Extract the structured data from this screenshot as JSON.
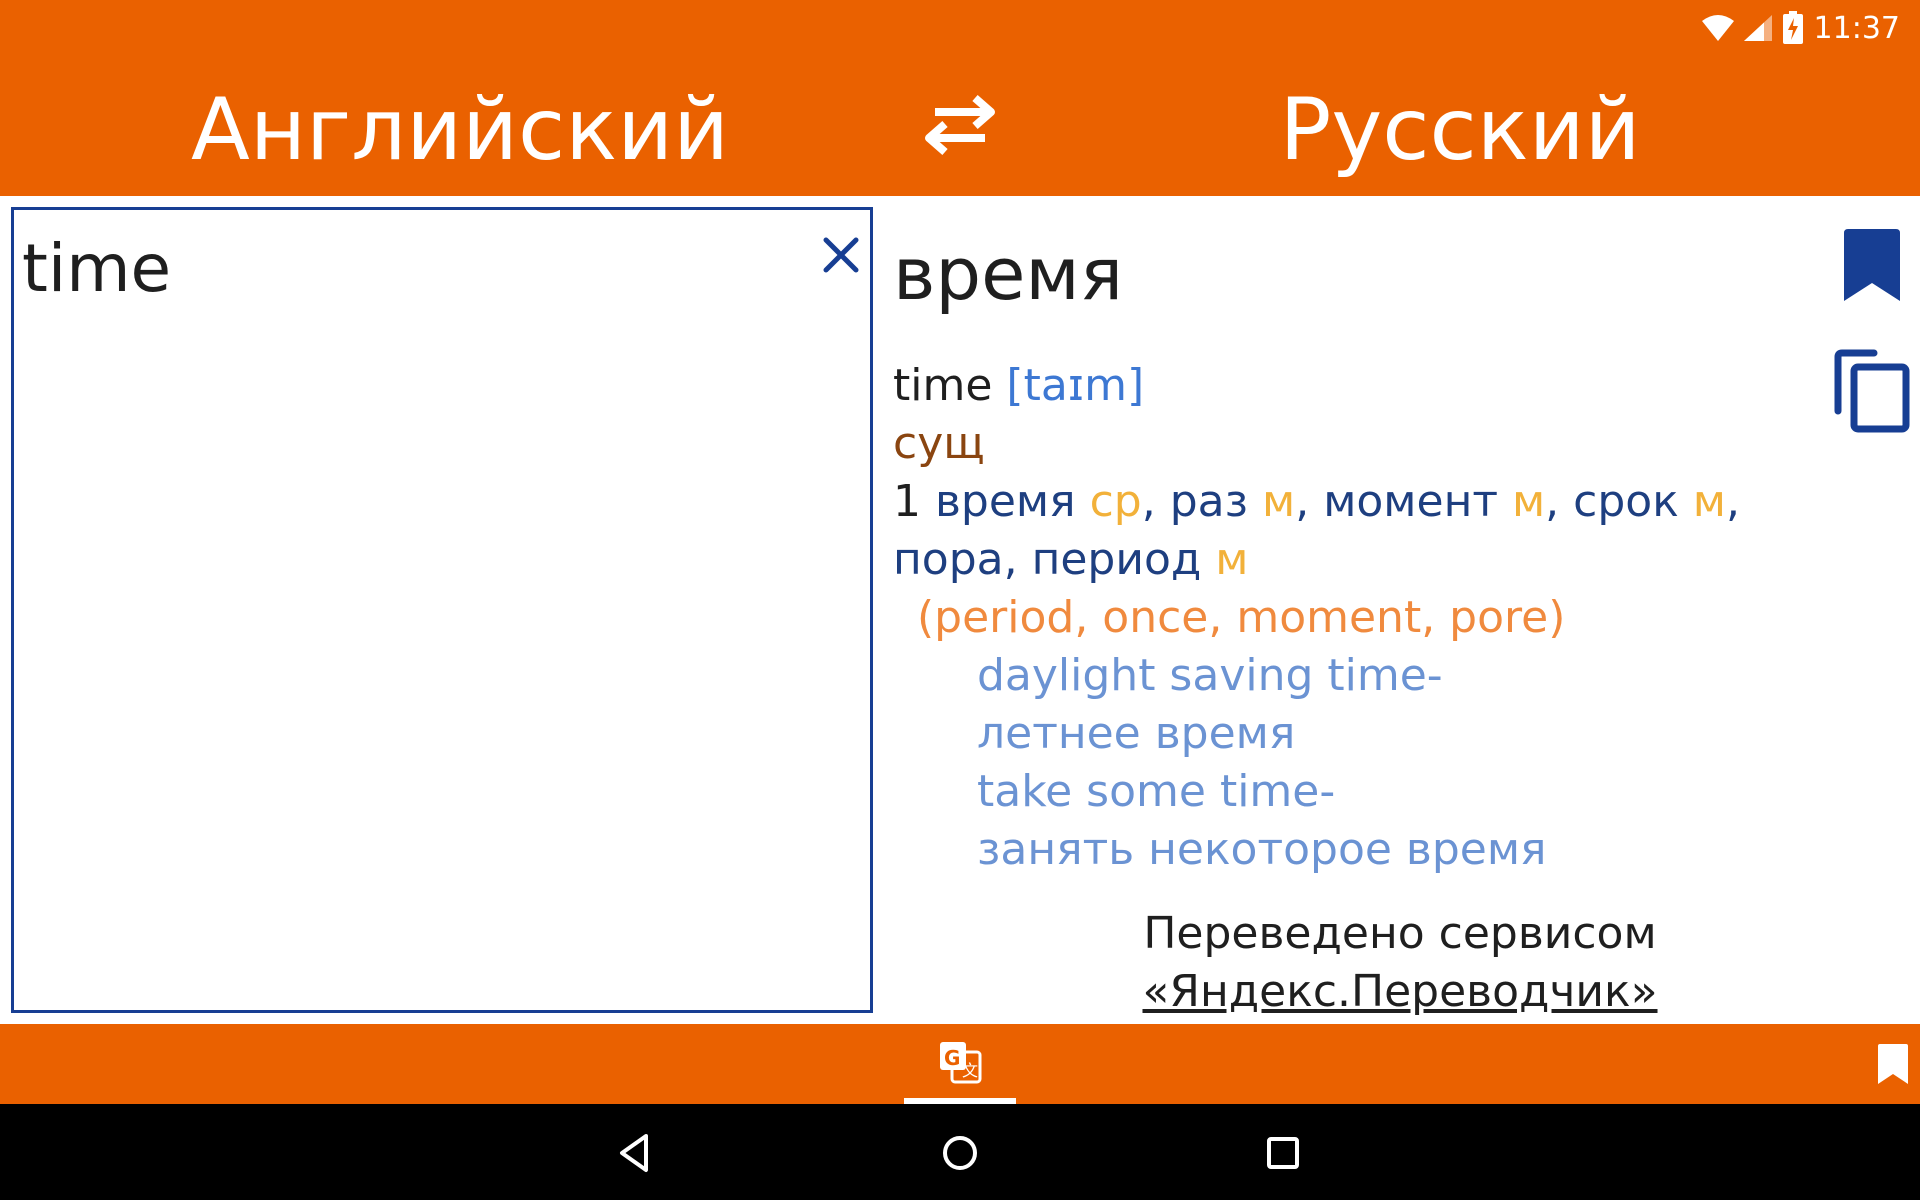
{
  "status": {
    "time": "11:37",
    "icons": [
      "wifi-icon",
      "signal-icon",
      "battery-charging-icon"
    ]
  },
  "header": {
    "source_language": "Английский",
    "target_language": "Русский",
    "swap_icon": "swap-arrows-icon"
  },
  "input": {
    "text": "time",
    "clear_icon": "close-icon"
  },
  "result": {
    "translation": "время",
    "dictionary": {
      "headword": "time",
      "transcription": "[taɪm]",
      "part_of_speech": "сущ",
      "sense_number": "1",
      "translations": [
        {
          "word": "время",
          "gender": "ср"
        },
        {
          "word": "раз",
          "gender": "м"
        },
        {
          "word": "момент",
          "gender": "м"
        },
        {
          "word": "срок",
          "gender": "м"
        },
        {
          "word": "пора",
          "gender": ""
        },
        {
          "word": "период",
          "gender": "м"
        }
      ],
      "meanings": "(period, once, moment, pore)",
      "examples": [
        {
          "source": "daylight saving time-",
          "target": "летнее время"
        },
        {
          "source": "take some time-",
          "target": "занять некоторое время"
        }
      ]
    }
  },
  "actions": {
    "bookmark_icon": "bookmark-icon",
    "copy_icon": "copy-icon"
  },
  "attribution": {
    "line1": "Переведено сервисом",
    "link": "«Яндекс.Переводчик»"
  },
  "bottom_nav": {
    "translate_icon": "translate-icon",
    "bookmarks_icon": "bookmark-icon"
  },
  "system_nav": [
    "back-icon",
    "home-icon",
    "recents-icon"
  ],
  "colors": {
    "accent": "#EA6100",
    "border": "#173E93",
    "transcription": "#3D78D3",
    "part_of_speech": "#8A4510",
    "translation": "#1E3F80",
    "gender": "#F2B13A",
    "meaning": "#F08A3E",
    "example": "#6B93D3"
  }
}
